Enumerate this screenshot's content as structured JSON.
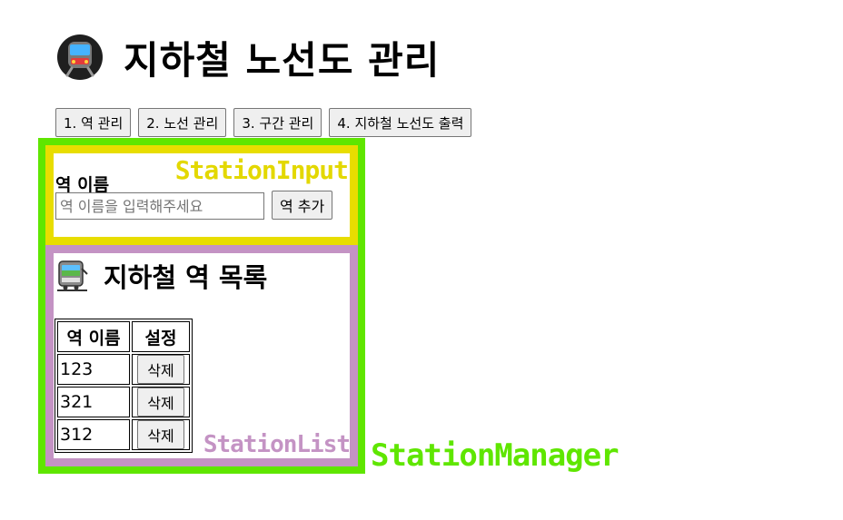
{
  "header": {
    "title": "지하철 노선도 관리",
    "icon": "metro-train-icon"
  },
  "nav": {
    "buttons": [
      {
        "label": "1. 역 관리"
      },
      {
        "label": "2. 노선 관리"
      },
      {
        "label": "3. 구간 관리"
      },
      {
        "label": "4. 지하철 노선도 출력"
      }
    ]
  },
  "station_manager": {
    "component_label": "StationManager",
    "color": "#5fe600",
    "station_input": {
      "component_label": "StationInput",
      "color": "#e8dd00",
      "field_label": "역 이름",
      "placeholder": "역 이름을 입력해주세요",
      "value": "",
      "add_button_label": "역 추가"
    },
    "station_list": {
      "component_label": "StationList",
      "color": "#c493c4",
      "title": "지하철 역 목록",
      "icon": "railway-car-icon",
      "columns": [
        "역 이름",
        "설정"
      ],
      "rows": [
        {
          "name": "123",
          "action": "삭제"
        },
        {
          "name": "321",
          "action": "삭제"
        },
        {
          "name": "312",
          "action": "삭제"
        }
      ]
    }
  }
}
